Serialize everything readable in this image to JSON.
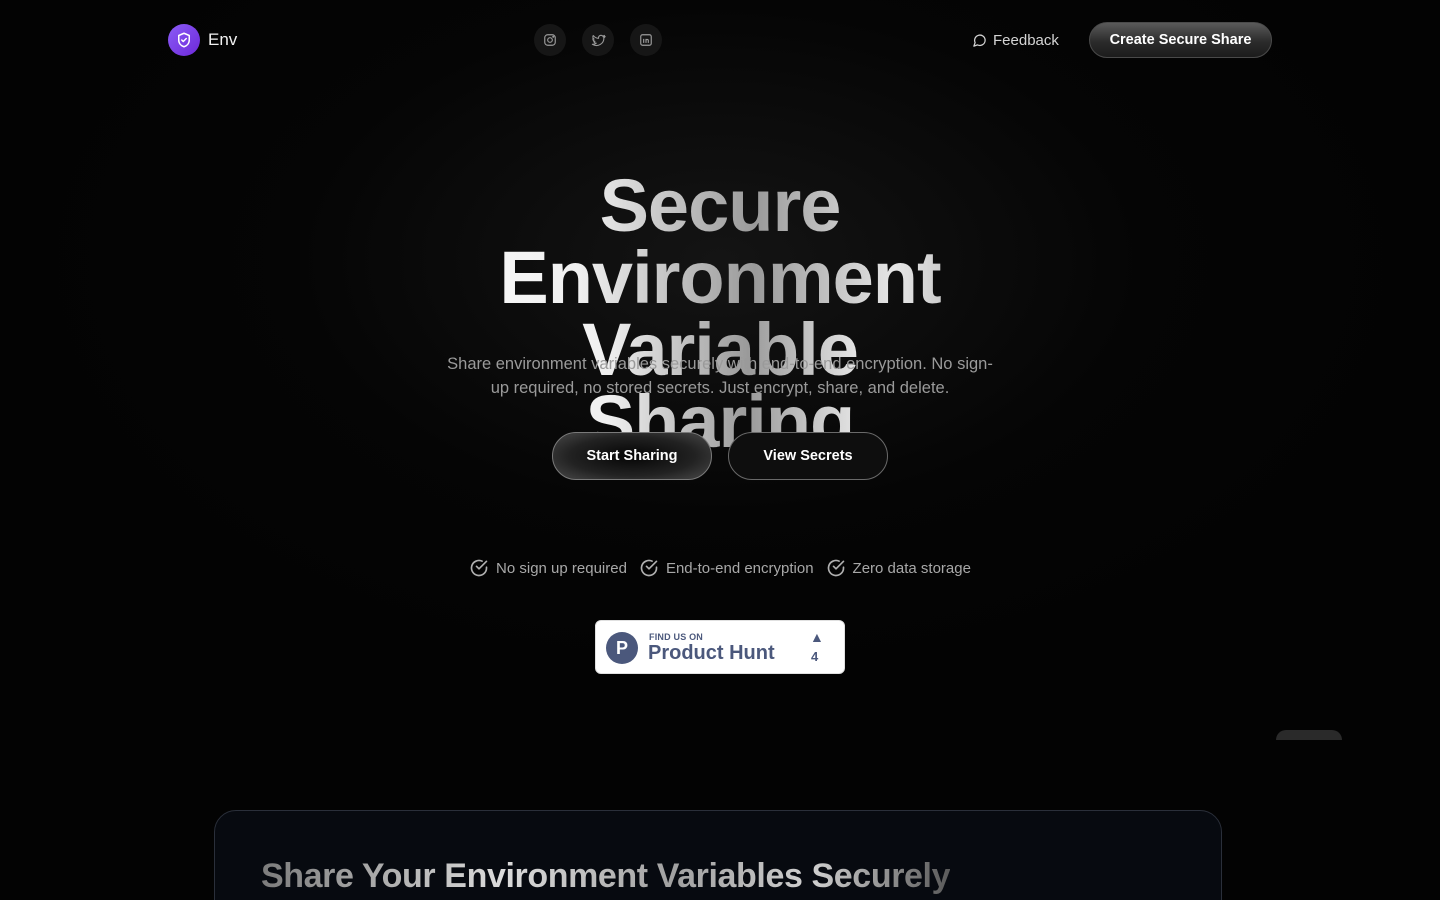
{
  "header": {
    "brand_name": "Env",
    "feedback_label": "Feedback",
    "cta_label": "Create Secure Share",
    "socials": [
      {
        "name": "instagram-icon"
      },
      {
        "name": "twitter-icon"
      },
      {
        "name": "linkedin-icon"
      }
    ]
  },
  "hero": {
    "title_line1": "Secure Environment",
    "title_line2": "Variable Sharing",
    "subtitle": "Share environment variables securely with end-to-end encryption. No sign-up required, no stored secrets. Just encrypt, share, and delete.",
    "primary_button": "Start Sharing",
    "secondary_button": "View Secrets",
    "features": [
      "No sign up required",
      "End-to-end encryption",
      "Zero data storage"
    ]
  },
  "product_hunt": {
    "logo_letter": "P",
    "find_us": "FIND US ON",
    "name": "Product Hunt",
    "arrow": "▲",
    "count": "4"
  },
  "card": {
    "title": "Share Your Environment Variables Securely"
  },
  "colors": {
    "brand": "#7c3aed",
    "product_hunt": "#4b587c",
    "background": "#030303"
  }
}
